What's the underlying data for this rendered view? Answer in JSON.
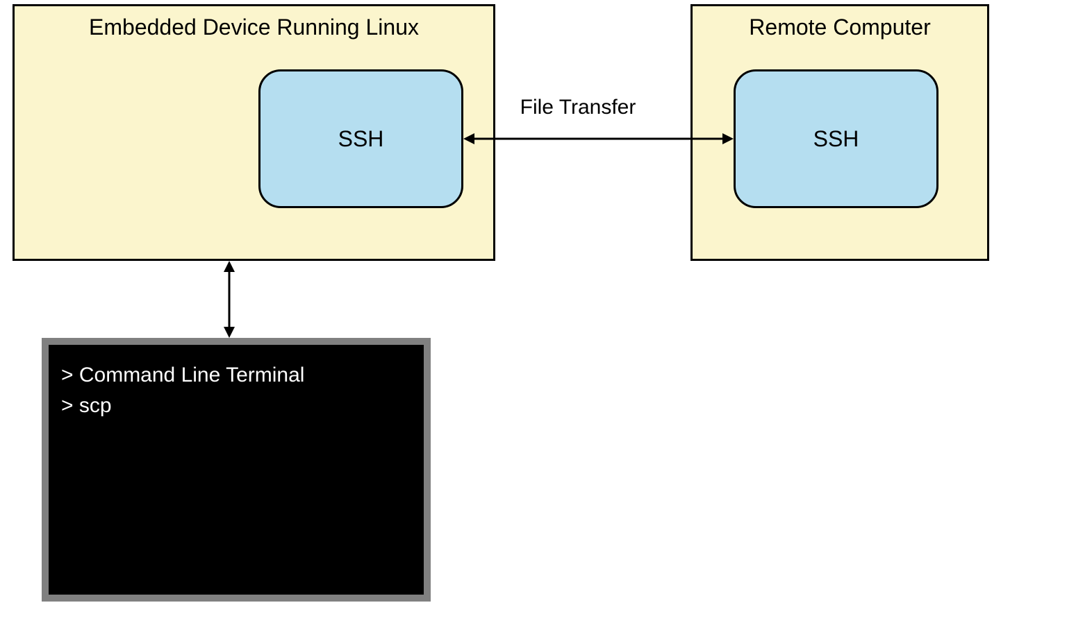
{
  "embedded": {
    "title": "Embedded Device Running Linux",
    "ssh_label": "SSH"
  },
  "remote": {
    "title": "Remote Computer",
    "ssh_label": "SSH"
  },
  "connection": {
    "label": "File Transfer"
  },
  "terminal": {
    "line1": "> Command Line Terminal",
    "line2": "> scp"
  }
}
